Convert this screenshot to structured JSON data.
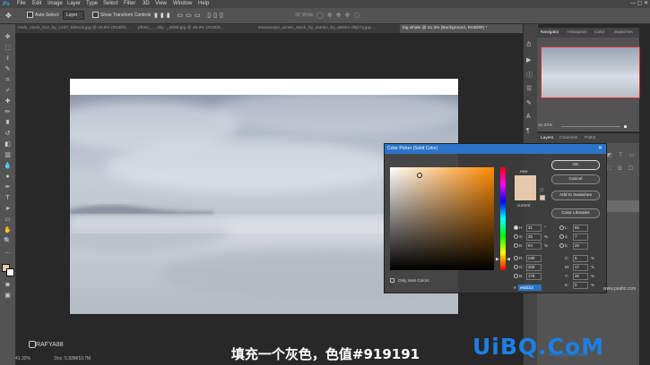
{
  "menubar": {
    "logo": "Ps",
    "items": [
      "File",
      "Edit",
      "Image",
      "Layer",
      "Type",
      "Select",
      "Filter",
      "3D",
      "View",
      "Window",
      "Help"
    ],
    "window_controls": "—  ▢  ✕"
  },
  "options_bar": {
    "auto_select_label": "Auto-Select:",
    "auto_select_value": "Layer",
    "show_transform_label": "Show Transform Controls",
    "mode_3d_label": "3D Mode:"
  },
  "tabs": [
    {
      "label": "male_stock_012_by_1337_tdstock.jpg @ 40.9% (RGB/8...",
      "active": false
    },
    {
      "label": "photo_..._sky..._6098.jpg @ 48.8% (RGB/8...",
      "active": false
    },
    {
      "label": "snowscape_winter_stock_by_astoko_by_astoko-d9jh7y.jpg ...",
      "active": false
    },
    {
      "label": "big whale @ 41.3% (Background, RGB/8#) *",
      "active": true
    }
  ],
  "status": {
    "zoom": "41.32%",
    "doc": "Doc: 5.93M/10.7M"
  },
  "navigator": {
    "tabs": [
      "Navigator",
      "Histogram",
      "Color",
      "Swatches"
    ],
    "zoom_value": "41.32%"
  },
  "layers": {
    "tabs": [
      "Layers",
      "Channels",
      "Paths"
    ]
  },
  "color_picker": {
    "title": "Color Picker (Solid Color)",
    "buttons": {
      "ok": "OK",
      "cancel": "Cancel",
      "add_to_swatches": "Add to Swatches",
      "color_libraries": "Color Libraries"
    },
    "new_label": "new",
    "current_label": "current",
    "only_web_label": "Only Web Colors",
    "hsb": {
      "h_label": "H:",
      "h_value": "31",
      "h_unit": "°",
      "s_label": "S:",
      "s_value": "25",
      "s_unit": "%",
      "b_label": "B:",
      "b_value": "94",
      "b_unit": "%"
    },
    "rgb": {
      "r_label": "R:",
      "r_value": "230",
      "g_label": "G:",
      "g_value": "209",
      "b_label": "B:",
      "b_value": "178"
    },
    "lab": {
      "l_label": "L:",
      "l_value": "86",
      "a_label": "a:",
      "a_value": "7",
      "b_label": "b:",
      "b_value": "20"
    },
    "cmyk": {
      "c_label": "C:",
      "c_value": "5",
      "c_unit": "%",
      "m_label": "M:",
      "m_value": "17",
      "m_unit": "%",
      "y_label": "Y:",
      "y_value": "30",
      "y_unit": "%",
      "k_label": "K:",
      "k_value": "0",
      "k_unit": "%"
    },
    "hex_label": "#",
    "hex_value": "e6d1b2",
    "new_color": "#e6c9aa",
    "current_color": "#e6c9aa"
  },
  "overlay": {
    "brand": "RAFYA88",
    "subtitle": "填充一个灰色，色值#919191",
    "site_logo": "UiBQ.CoM",
    "site_sub": "www.psahz.com",
    "watermark2": "www.psahz.com"
  }
}
